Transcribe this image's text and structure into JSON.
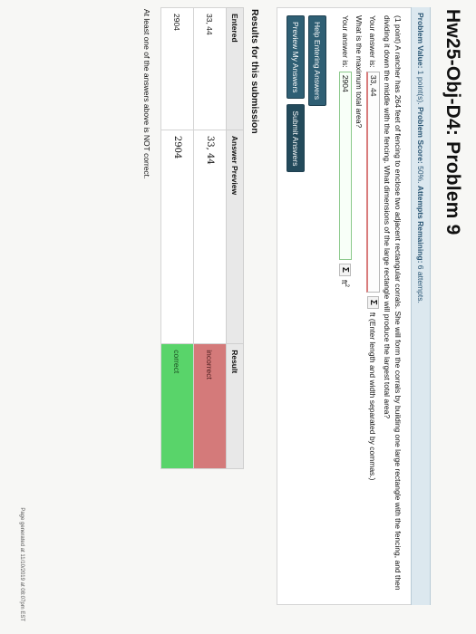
{
  "page": {
    "title": "Hw25-Obj-D4: Problem 9",
    "footer": "Page generated at 11/10/2019 at 08:07pm EST"
  },
  "problem_header": {
    "value_label": "Problem Value:",
    "value": "1 point(s).",
    "score_label": "Problem Score:",
    "score": "50%.",
    "attempts_label": "Attempts Remaining:",
    "attempts": "6 attempts."
  },
  "problem": {
    "text": "(1 point) A rancher has 264 feet of fencing to enclose two adjacent rectangular corrals. She will form the corrals by building one large rectangle with the fencing, and then dividing it down the middle with the fencing. What dimensions of the large rectangle will produce the largest total area?",
    "q1_label": "Your answer is:",
    "q1_value": "33, 44",
    "q1_suffix": "ft (Enter length and width separated by commas.)",
    "q2_prompt": "What is the maximum total area?",
    "q2_label": "Your answer is:",
    "q2_value": "2904",
    "q2_unit": "ft",
    "q2_unit_sup": "2",
    "sigma_label": "Σ"
  },
  "buttons": {
    "help": "Help Entering Answers",
    "preview": "Preview My Answers",
    "submit": "Submit Answers"
  },
  "results": {
    "title": "Results for this submission",
    "headers": [
      "Entered",
      "Answer Preview",
      "Result"
    ],
    "rows": [
      {
        "entered": "33, 44",
        "preview": "33, 44",
        "result": "incorrect"
      },
      {
        "entered": "2904",
        "preview": "2904",
        "result": "correct"
      }
    ],
    "summary": "At least one of the answers above is NOT correct."
  },
  "colors": {
    "incorrect": "#d47a7a",
    "correct": "#59d46a",
    "header_bg": "#dce8ef",
    "button": "#2f5f74"
  }
}
